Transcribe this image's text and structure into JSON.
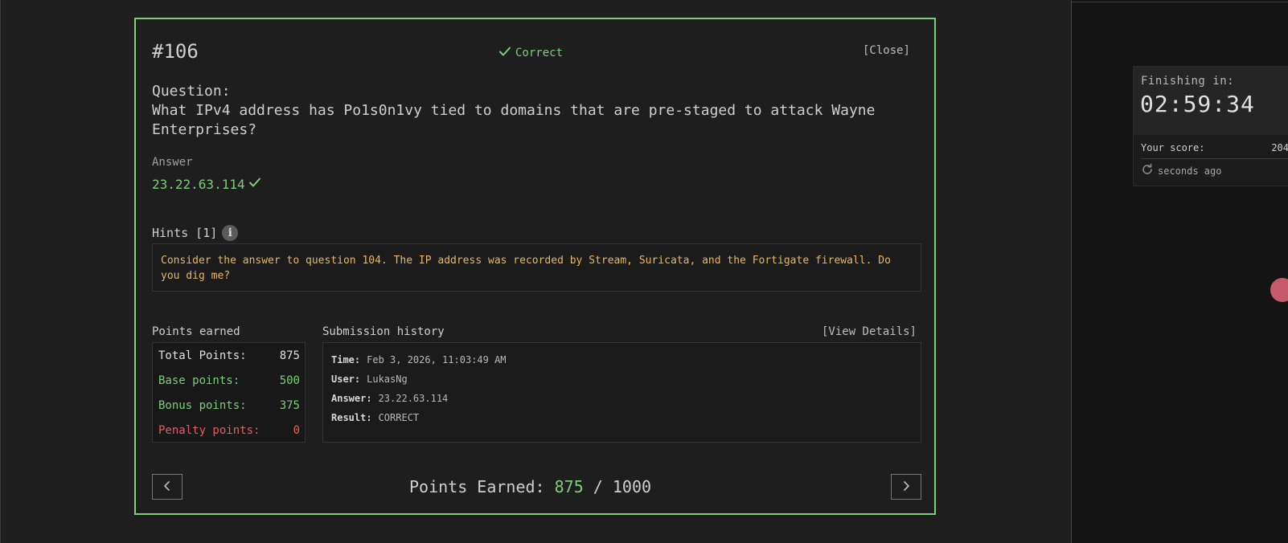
{
  "sidebar": {
    "timer_label": "Finishing in:",
    "timer_value": "02:59:34",
    "score_label": "Your score:",
    "score_value": "204",
    "refresh_text": "seconds ago"
  },
  "modal": {
    "question_number": "#106",
    "status": "Correct",
    "close_label": "[Close]",
    "question_label": "Question:",
    "question_text": "What IPv4 address has Po1s0n1vy tied to domains that are pre-staged to attack Wayne Enterprises?",
    "answer_label": "Answer",
    "answer_value": "23.22.63.114",
    "hints_label": "Hints [1]",
    "hint_text": "Consider the answer to question 104. The IP address was recorded by Stream, Suricata, and the Fortigate firewall. Do you dig me?",
    "points": {
      "label": "Points earned",
      "total_label": "Total Points:",
      "total_value": "875",
      "base_label": "Base points:",
      "base_value": "500",
      "bonus_label": "Bonus points:",
      "bonus_value": "375",
      "penalty_label": "Penalty points:",
      "penalty_value": "0"
    },
    "history": {
      "label": "Submission history",
      "view_details_label": "[View Details]",
      "time_label": "Time:",
      "time_value": "Feb 3, 2026, 11:03:49 AM",
      "user_label": "User:",
      "user_value": "LukasNg",
      "answer_label": "Answer:",
      "answer_value": "23.22.63.114",
      "result_label": "Result:",
      "result_value": "CORRECT"
    },
    "footer": {
      "prefix": "Points Earned:",
      "earned": "875",
      "separator": "/",
      "max": "1000"
    }
  },
  "colors": {
    "accent_green": "#7ccd7c",
    "hint_orange": "#e8b862",
    "penalty_red": "#e06060"
  },
  "icons": {
    "status": "checkmark-icon",
    "answer": "checkmark-icon",
    "hints": "info-icon",
    "refresh": "refresh-icon",
    "prev": "chevron-left-icon",
    "next": "chevron-right-icon"
  }
}
